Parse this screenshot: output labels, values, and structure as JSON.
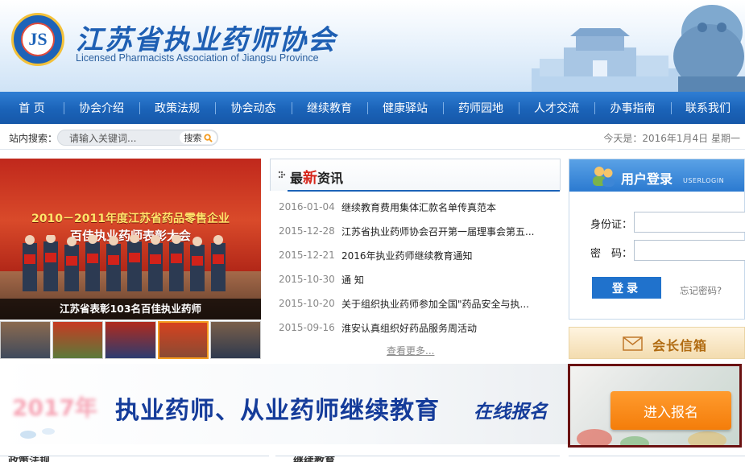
{
  "header": {
    "logo_cn": "江苏省执业药师协会",
    "logo_en": "Licensed Pharmacists Association of Jiangsu Province",
    "emblem_mark": "JS"
  },
  "nav": {
    "items": [
      "首 页",
      "协会介绍",
      "政策法规",
      "协会动态",
      "继续教育",
      "健康驿站",
      "药师园地",
      "人才交流",
      "办事指南",
      "联系我们"
    ]
  },
  "search": {
    "label": "站内搜索：",
    "placeholder": "请输入关键词...",
    "button": "搜索",
    "date": "今天是：2016年1月4日 星期一"
  },
  "slider": {
    "banner_title": "2010－2011年度江苏省药品零售企业",
    "banner_sub": "百佳执业药师表彰大会",
    "caption": "江苏省表彰103名百佳执业药师",
    "active_thumb": 3
  },
  "news": {
    "title_prefix": "最",
    "title_highlight": "新",
    "title_suffix": "资讯",
    "items": [
      {
        "date": "2016-01-04",
        "title": "继续教育费用集体汇款名单传真范本"
      },
      {
        "date": "2015-12-28",
        "title": "江苏省执业药师协会召开第一届理事会第五..."
      },
      {
        "date": "2015-12-21",
        "title": "2016年执业药师继续教育通知"
      },
      {
        "date": "2015-10-30",
        "title": "通 知"
      },
      {
        "date": "2015-10-20",
        "title": "关于组织执业药师参加全国\"药品安全与执..."
      },
      {
        "date": "2015-09-16",
        "title": "淮安认真组织好药品服务周活动"
      }
    ],
    "more": "查看更多..."
  },
  "login": {
    "title": "用户登录",
    "title_en": "USERLOGIN",
    "id_label": "身份证：",
    "pwd_label": "密　码：",
    "button": "登录",
    "forgot": "忘记密码?"
  },
  "mailbox": {
    "label": "会长信箱"
  },
  "edu_banner": {
    "year": "2017年",
    "text": "执业药师、从业药师继续教育",
    "text2": "在线报名",
    "enroll": "进入报名"
  },
  "bottom": {
    "sec1": "政策法规",
    "sec2": "继续教育"
  },
  "colors": {
    "brand_blue": "#1b63b8",
    "accent_red": "#d6261b",
    "enroll_orange": "#f47d0a"
  }
}
